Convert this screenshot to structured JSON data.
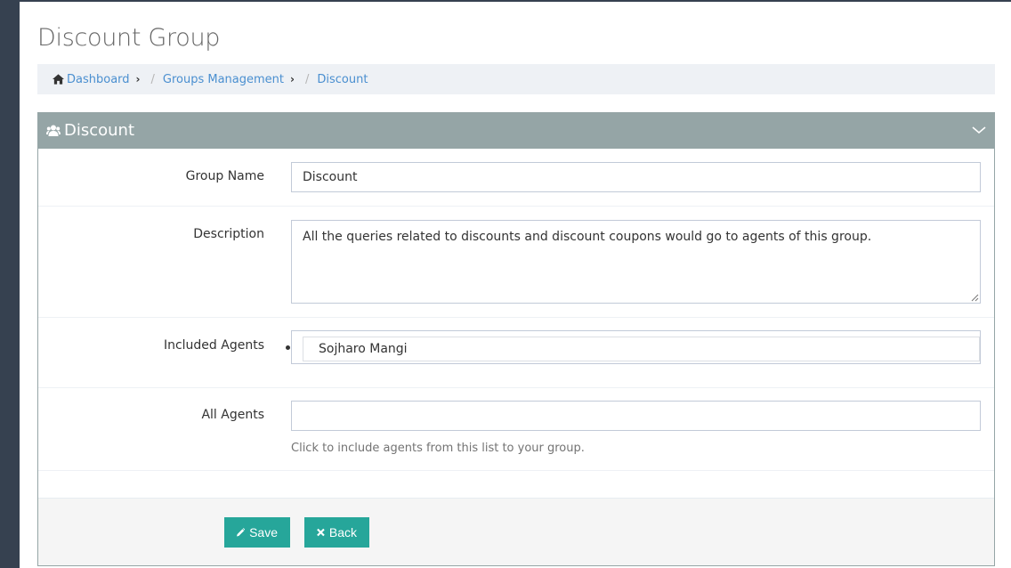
{
  "page": {
    "title": "Discount Group"
  },
  "breadcrumb": {
    "items": [
      "Dashboard",
      "Groups Management",
      "Discount"
    ]
  },
  "portlet": {
    "title": "Discount",
    "header_color": "#95a5a6"
  },
  "form": {
    "group_name": {
      "label": "Group Name",
      "value": "Discount"
    },
    "description": {
      "label": "Description",
      "value": "All the queries related to discounts and discount coupons would go to agents of this group."
    },
    "included_agents": {
      "label": "Included Agents",
      "items": [
        "Sojharo Mangi"
      ]
    },
    "all_agents": {
      "label": "All Agents",
      "value": "",
      "help": "Click to include agents from this list to your group."
    }
  },
  "actions": {
    "save_label": "Save",
    "back_label": "Back",
    "button_color": "#26a69a"
  },
  "icons": [
    "home-icon",
    "chevron-right-icon",
    "users-icon",
    "chevron-down-icon",
    "pencil-icon",
    "times-icon"
  ]
}
